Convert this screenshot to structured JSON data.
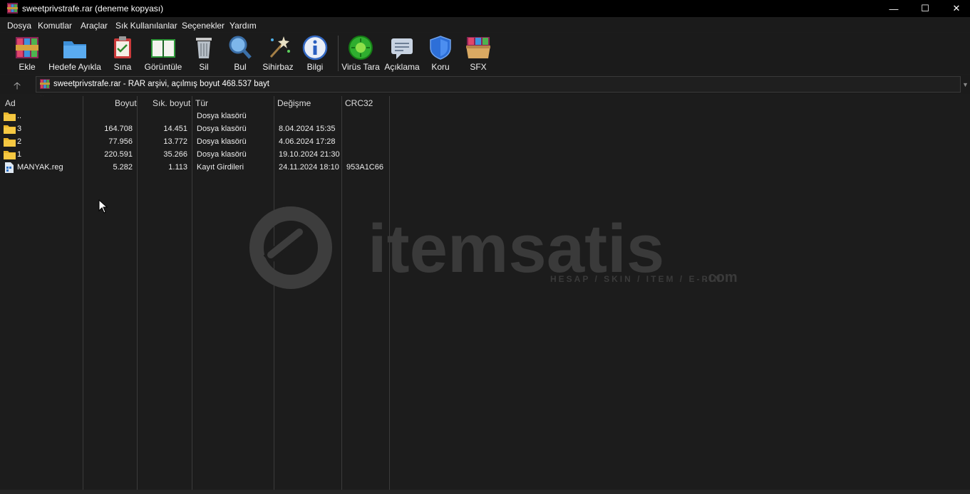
{
  "window": {
    "title": "sweetprivstrafe.rar (deneme kopyası)",
    "controls": {
      "minimize": "—",
      "maximize": "☐",
      "close": "✕"
    }
  },
  "menu": [
    {
      "label": "Dosya"
    },
    {
      "label": "Komutlar"
    },
    {
      "label": "Araçlar"
    },
    {
      "label": "Sık Kullanılanlar"
    },
    {
      "label": "Seçenekler"
    },
    {
      "label": "Yardım"
    }
  ],
  "toolbar": [
    {
      "label": "Ekle",
      "icon": "add-icon"
    },
    {
      "label": "Hedefe Ayıkla",
      "icon": "extract-folder-icon"
    },
    {
      "label": "Sına",
      "icon": "test-clipboard-icon"
    },
    {
      "label": "Görüntüle",
      "icon": "view-book-icon"
    },
    {
      "label": "Sil",
      "icon": "trash-icon"
    },
    {
      "label": "Bul",
      "icon": "magnifier-icon"
    },
    {
      "label": "Sihirbaz",
      "icon": "wizard-wand-icon"
    },
    {
      "label": "Bilgi",
      "icon": "info-icon"
    },
    {
      "label": "Virüs Tara",
      "icon": "virus-scan-icon"
    },
    {
      "label": "Açıklama",
      "icon": "comment-icon"
    },
    {
      "label": "Koru",
      "icon": "shield-icon"
    },
    {
      "label": "SFX",
      "icon": "sfx-box-icon"
    }
  ],
  "address": {
    "text": "sweetprivstrafe.rar - RAR arşivi, açılmış boyut 468.537 bayt",
    "up_symbol": "🡡"
  },
  "columns": [
    "Ad",
    "Boyut",
    "Sık. boyut",
    "Tür",
    "Değişme",
    "CRC32"
  ],
  "files": [
    {
      "name": "..",
      "size": "",
      "packed": "",
      "type": "Dosya klasörü",
      "modified": "",
      "crc": "",
      "kind": "folder"
    },
    {
      "name": "3",
      "size": "164.708",
      "packed": "14.451",
      "type": "Dosya klasörü",
      "modified": "8.04.2024 15:35",
      "crc": "",
      "kind": "folder"
    },
    {
      "name": "2",
      "size": "77.956",
      "packed": "13.772",
      "type": "Dosya klasörü",
      "modified": "4.06.2024 17:28",
      "crc": "",
      "kind": "folder"
    },
    {
      "name": "1",
      "size": "220.591",
      "packed": "35.266",
      "type": "Dosya klasörü",
      "modified": "19.10.2024 21:30",
      "crc": "",
      "kind": "folder"
    },
    {
      "name": "MANYAK.reg",
      "size": "5.282",
      "packed": "1.113",
      "type": "Kayıt Girdileri",
      "modified": "24.11.2024 18:10",
      "crc": "953A1C66",
      "kind": "reg"
    }
  ],
  "watermark": {
    "brand": "itemsatis",
    "tagline": "HESAP / SKIN / ITEM / E-PIN",
    "suffix": ".com"
  },
  "colors": {
    "background": "#1c1c1c",
    "titlebar": "#000000",
    "text": "#e6e6e6",
    "folder": "#f2c12e"
  }
}
